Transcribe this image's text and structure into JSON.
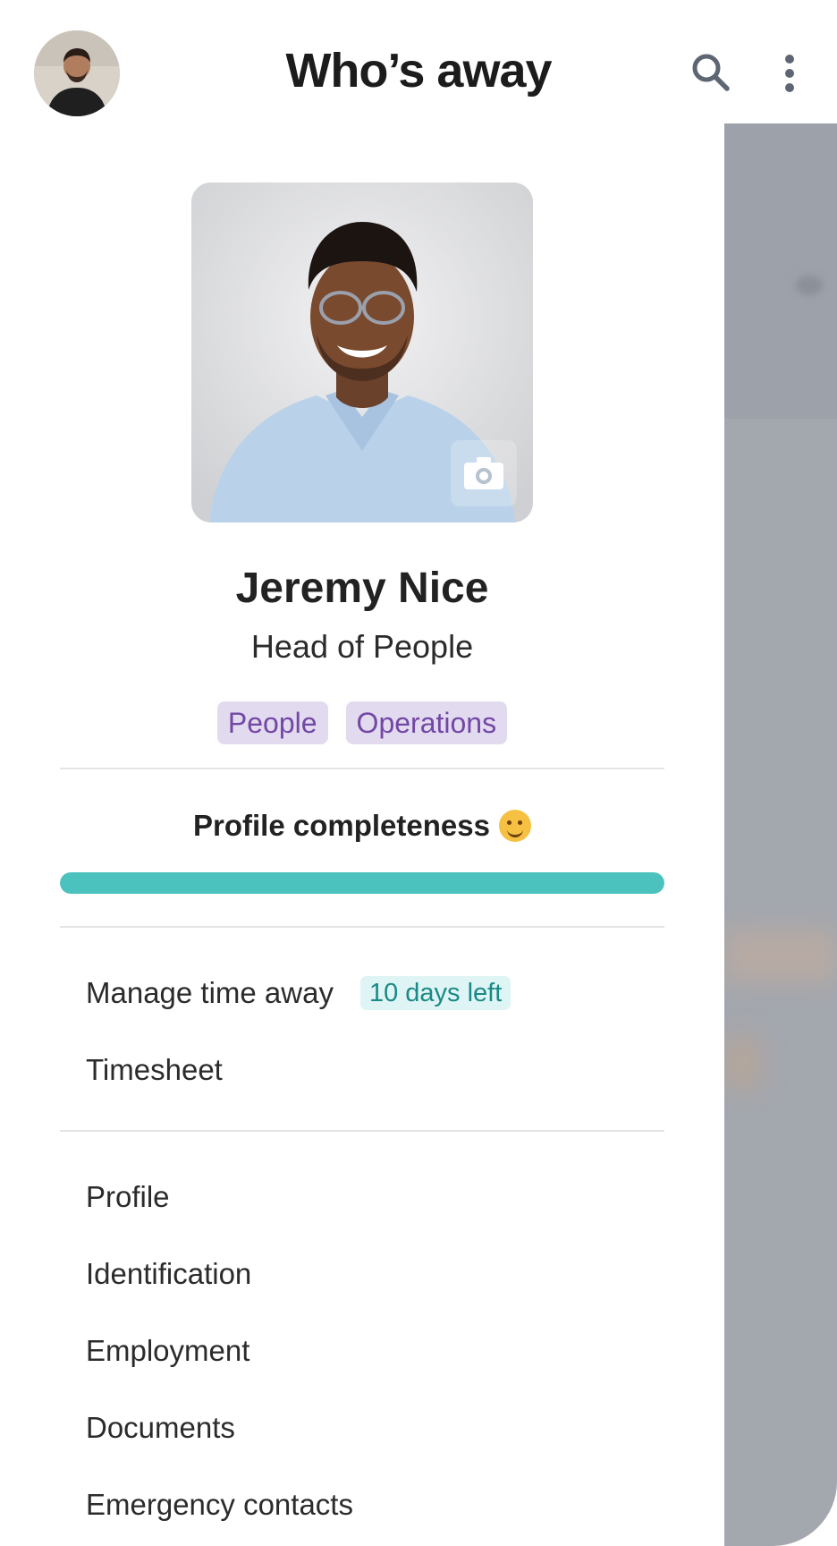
{
  "header": {
    "title": "Who’s away",
    "avatar_icon": "user-avatar",
    "search_icon": "search-icon",
    "more_icon": "more-vertical-icon"
  },
  "profile": {
    "name": "Jeremy Nice",
    "role": "Head of People",
    "tags": [
      "People",
      "Operations"
    ],
    "photo_icon": "profile-photo",
    "camera_icon": "camera-icon"
  },
  "completeness": {
    "title": "Profile completeness",
    "emoji": "hugging-face-emoji",
    "progress_percent": 100,
    "color": "#4cc2bf"
  },
  "menu_primary": [
    {
      "label": "Manage time away",
      "badge": "10 days left"
    },
    {
      "label": "Timesheet"
    }
  ],
  "menu_secondary": [
    {
      "label": "Profile"
    },
    {
      "label": "Identification"
    },
    {
      "label": "Employment"
    },
    {
      "label": "Documents"
    },
    {
      "label": "Emergency contacts"
    }
  ],
  "colors": {
    "tag_bg": "#e2dbef",
    "tag_text": "#7347a5",
    "badge_bg": "#dff4f4",
    "badge_text": "#1a8a86",
    "backdrop": "#a3a7ae"
  }
}
